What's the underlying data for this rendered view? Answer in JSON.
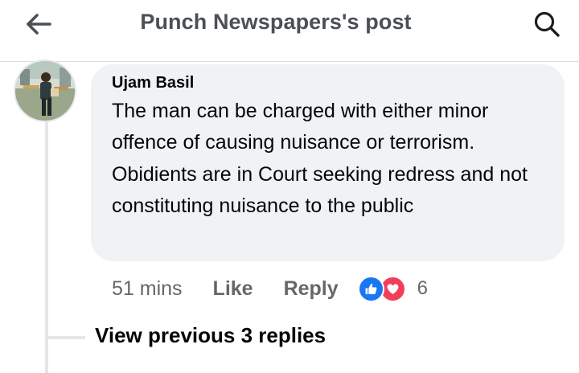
{
  "header": {
    "title": "Punch Newspapers's post",
    "back_icon": "arrow-left-icon",
    "search_icon": "search-icon"
  },
  "comment": {
    "author": "Ujam Basil",
    "text": "The man can be charged with either minor offence of causing nuisance or terrorism. Obidients are in Court seeking redress and not constituting nuisance to the public",
    "time": "51 mins",
    "like_label": "Like",
    "reply_label": "Reply",
    "reaction_count": "6",
    "reactions": [
      "like-reaction-icon",
      "love-reaction-icon"
    ]
  },
  "thread": {
    "view_previous_label": "View previous 3 replies"
  },
  "colors": {
    "header_text": "#4b4f56",
    "bubble_bg": "#f0f2f5",
    "meta_text": "#65676b",
    "like_blue": "#1877f2",
    "love_red": "#f33e58"
  }
}
